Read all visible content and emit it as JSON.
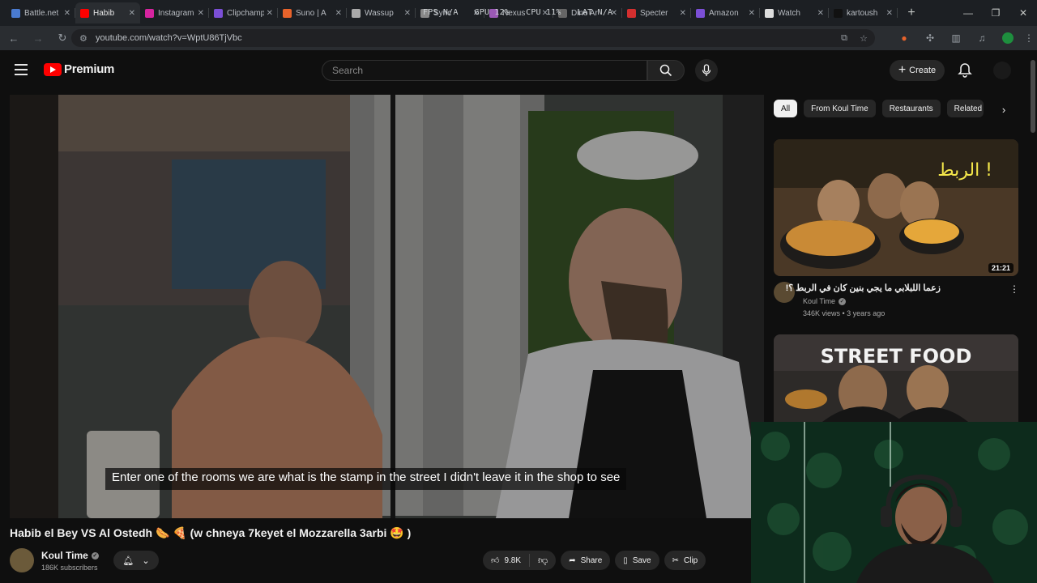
{
  "browser": {
    "tabs": [
      {
        "label": "Battle.net",
        "color": "#4a7bd0"
      },
      {
        "label": "Habib",
        "color": "#ff0000",
        "active": true
      },
      {
        "label": "Instagram",
        "color": "#d6249f"
      },
      {
        "label": "Clipchamp",
        "color": "#7b4fd6"
      },
      {
        "label": "Suno | A",
        "color": "#e8632b"
      },
      {
        "label": "Wassup",
        "color": "#aaaaaa"
      },
      {
        "label": "Sync",
        "color": "#888888"
      },
      {
        "label": "Nexus",
        "color": "#9b59b6"
      },
      {
        "label": "Dino Ar",
        "color": "#666666"
      },
      {
        "label": "Specter",
        "color": "#d32f2f"
      },
      {
        "label": "Amazon",
        "color": "#7b4fd6"
      },
      {
        "label": "Watch",
        "color": "#dddddd"
      },
      {
        "label": "kartoush",
        "color": "#111111"
      }
    ],
    "perf_overlay": {
      "fps": "FPS N/A",
      "gpu": "GPU 12%",
      "cpu": "CPU 11%",
      "lat": "LAT N/A"
    },
    "url": "youtube.com/watch?v=WptU86TjVbc"
  },
  "youtube": {
    "logo_text": "Premium",
    "search_placeholder": "Search",
    "create_label": "Create"
  },
  "video": {
    "subtitle": "Enter one of the rooms we are what is the stamp in the street I didn't leave it in the shop to see",
    "title": "Habib el Bey VS Al Ostedh 🌭 🍕 (w chneya 7keyet el Mozzarella 3arbi 🤩 )",
    "channel": "Koul Time",
    "subscribers": "186K subscribers",
    "likes": "9.8K",
    "share_label": "Share",
    "save_label": "Save",
    "clip_label": "Clip"
  },
  "sidebar": {
    "chips": [
      "All",
      "From Koul Time",
      "Restaurants",
      "Related"
    ],
    "recommended": [
      {
        "title": "زعما اللبلابي ما يجي بنين كان في الربط ؟!",
        "channel": "Koul Time",
        "meta": "346K views • 3 years ago",
        "duration": "21:21",
        "thumb_text": "الربط !"
      },
      {
        "thumb_text": "STREET FOOD"
      }
    ]
  },
  "colors": {
    "accent": "#ff0000",
    "background": "#0f0f0f",
    "chip": "#272727"
  }
}
